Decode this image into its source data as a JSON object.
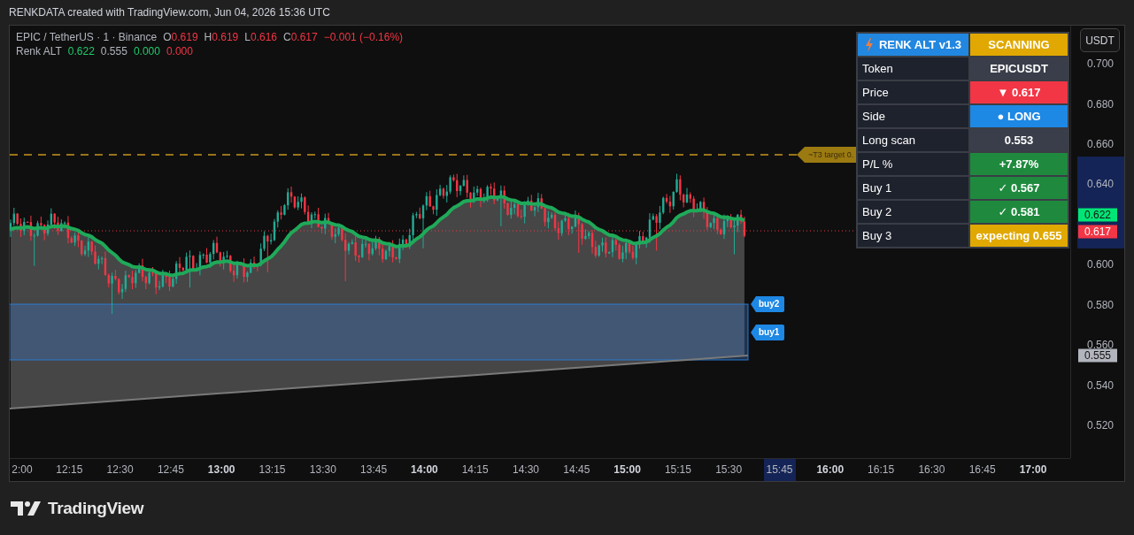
{
  "header": {
    "text": "RENKDATA created with TradingView.com, Jun 04, 2026 15:36 UTC"
  },
  "legend": {
    "symbol": "EPIC / TetherUS · 1 · Binance",
    "ohlc": [
      {
        "label": "O",
        "value": "0.619"
      },
      {
        "label": "H",
        "value": "0.619"
      },
      {
        "label": "L",
        "value": "0.616"
      },
      {
        "label": "C",
        "value": "0.617"
      }
    ],
    "change": "−0.001 (−0.16%)",
    "indicator": {
      "name": "Renk ALT",
      "values": [
        {
          "value": "0.622",
          "color": "#1ecb6b"
        },
        {
          "value": "0.555",
          "color": "#b2b5be"
        },
        {
          "value": "0.000",
          "color": "#1ecb6b"
        },
        {
          "value": "0.000",
          "color": "#f23645"
        }
      ]
    }
  },
  "chart_labels": {
    "target": "~T3 target 0.",
    "buy_tags": [
      "buy2",
      "buy1"
    ]
  },
  "panel": {
    "header": [
      {
        "text": "RENK ALT v1.3",
        "color": "#2187e0"
      },
      {
        "text": "SCANNING",
        "color": "#e0a800"
      }
    ],
    "rows": [
      {
        "label": "Token",
        "value": "EPICUSDT",
        "color": "#3a3e4a"
      },
      {
        "label": "Price",
        "value": "▼ 0.617",
        "color": "#f23645"
      },
      {
        "label": "Side",
        "value": "● LONG",
        "color": "#1e88e5"
      },
      {
        "label": "Long scan",
        "value": "0.553",
        "color": "#3a3e4a"
      },
      {
        "label": "P/L %",
        "value": "+7.87%",
        "color": "#1f8a3e"
      },
      {
        "label": "Buy 1",
        "value": "✓ 0.567",
        "color": "#1f8a3e"
      },
      {
        "label": "Buy 2",
        "value": "✓ 0.581",
        "color": "#1f8a3e"
      },
      {
        "label": "Buy 3",
        "value": "expecting 0.655",
        "color": "#e0a800"
      }
    ]
  },
  "price_axis": {
    "currency": "USDT",
    "labels": [
      "0.700",
      "0.680",
      "0.660",
      "0.640",
      "0.600",
      "0.580",
      "0.560",
      "0.540",
      "0.520"
    ],
    "tags": [
      {
        "value": "0.622",
        "color": "#00e676"
      },
      {
        "value": "0.617",
        "color": "#f23645"
      },
      {
        "value": "0.555",
        "color": "#b2b5be"
      }
    ]
  },
  "time_axis": [
    {
      "label": "2:00",
      "major": false,
      "highlighted": false
    },
    {
      "label": "12:15",
      "major": false,
      "highlighted": false
    },
    {
      "label": "12:30",
      "major": false,
      "highlighted": false
    },
    {
      "label": "12:45",
      "major": false,
      "highlighted": false
    },
    {
      "label": "13:00",
      "major": true,
      "highlighted": false
    },
    {
      "label": "13:15",
      "major": false,
      "highlighted": false
    },
    {
      "label": "13:30",
      "major": false,
      "highlighted": false
    },
    {
      "label": "13:45",
      "major": false,
      "highlighted": false
    },
    {
      "label": "14:00",
      "major": true,
      "highlighted": false
    },
    {
      "label": "14:15",
      "major": false,
      "highlighted": false
    },
    {
      "label": "14:30",
      "major": false,
      "highlighted": false
    },
    {
      "label": "14:45",
      "major": false,
      "highlighted": false
    },
    {
      "label": "15:00",
      "major": true,
      "highlighted": false
    },
    {
      "label": "15:15",
      "major": false,
      "highlighted": false
    },
    {
      "label": "15:30",
      "major": false,
      "highlighted": false
    },
    {
      "label": "15:45",
      "major": false,
      "highlighted": true
    },
    {
      "label": "16:00",
      "major": true,
      "highlighted": false
    },
    {
      "label": "16:15",
      "major": false,
      "highlighted": false
    },
    {
      "label": "16:30",
      "major": false,
      "highlighted": false
    },
    {
      "label": "16:45",
      "major": false,
      "highlighted": false
    },
    {
      "label": "17:00",
      "major": true,
      "highlighted": false
    }
  ],
  "footer": {
    "brand": "TradingView"
  }
}
